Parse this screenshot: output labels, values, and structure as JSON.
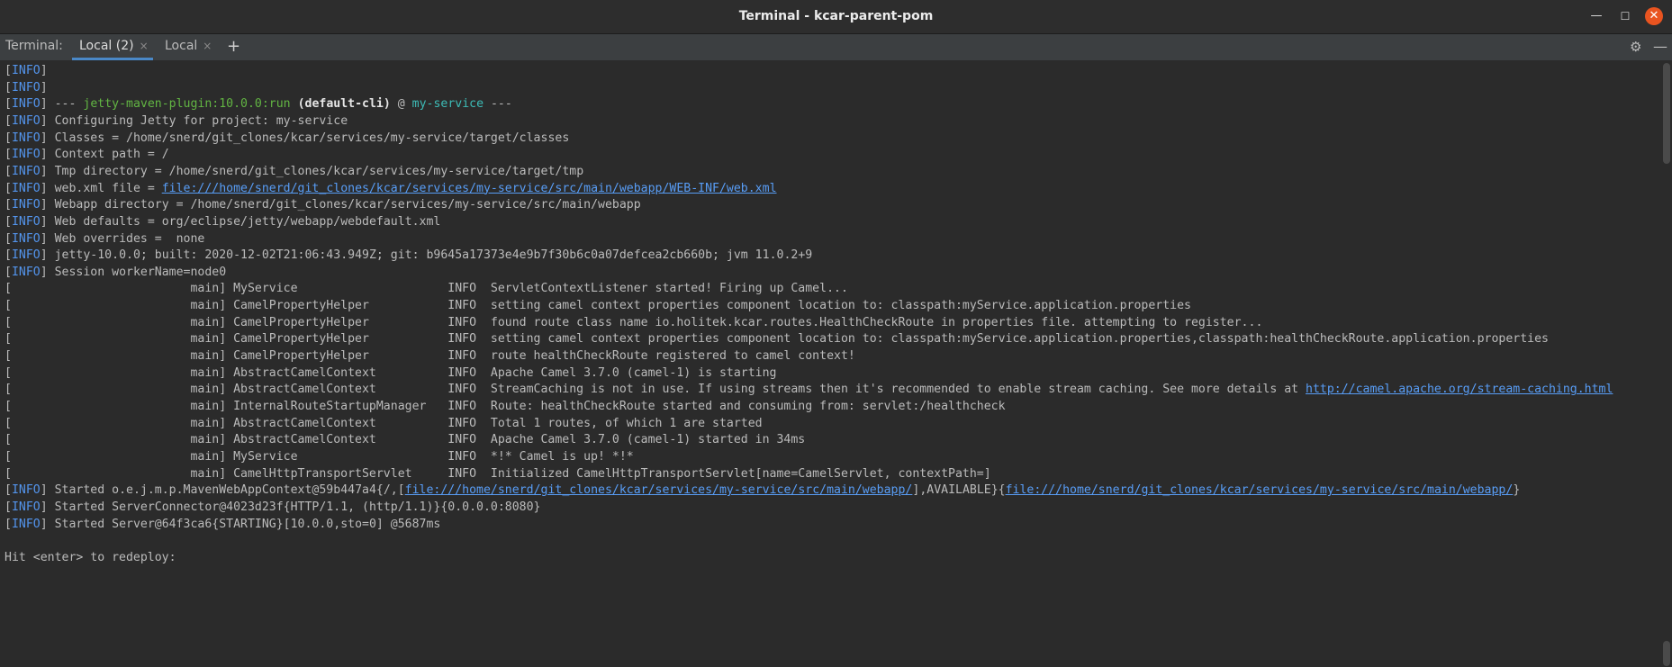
{
  "window": {
    "title": "Terminal - kcar-parent-pom",
    "minimize": "—",
    "maximize": "☐",
    "close": "✕"
  },
  "toolbar": {
    "label": "Terminal:",
    "tabs": [
      {
        "label": "Local (2)",
        "close": "×"
      },
      {
        "label": "Local",
        "close": "×"
      }
    ],
    "add": "+",
    "settings_glyph": "⚙",
    "hide_glyph": "—"
  },
  "log": {
    "tag": "INFO",
    "lines": [
      {
        "type": "info",
        "text": ""
      },
      {
        "type": "info",
        "text": ""
      },
      {
        "type": "plugin",
        "dashes": "---",
        "plugin": "jetty-maven-plugin:10.0.0:run",
        "exec": "(default-cli)",
        "at": "@",
        "module": "my-service",
        "end": "---"
      },
      {
        "type": "info",
        "text": "Configuring Jetty for project: my-service"
      },
      {
        "type": "info",
        "text": "Classes = /home/snerd/git_clones/kcar/services/my-service/target/classes"
      },
      {
        "type": "info",
        "text": "Context path = /"
      },
      {
        "type": "info",
        "text": "Tmp directory = /home/snerd/git_clones/kcar/services/my-service/target/tmp"
      },
      {
        "type": "info",
        "text": "web.xml file = ",
        "link": "file:///home/snerd/git_clones/kcar/services/my-service/src/main/webapp/WEB-INF/web.xml"
      },
      {
        "type": "info",
        "text": "Webapp directory = /home/snerd/git_clones/kcar/services/my-service/src/main/webapp"
      },
      {
        "type": "info",
        "text": "Web defaults = org/eclipse/jetty/webapp/webdefault.xml"
      },
      {
        "type": "info",
        "text": "Web overrides =  none"
      },
      {
        "type": "info",
        "text": "jetty-10.0.0; built: 2020-12-02T21:06:43.949Z; git: b9645a17373e4e9b7f30b6c0a07defcea2cb660b; jvm 11.0.2+9"
      },
      {
        "type": "info",
        "text": "Session workerName=node0"
      },
      {
        "type": "log",
        "thread": "main]",
        "logger": "MyService",
        "level": "INFO",
        "msg": "ServletContextListener started! Firing up Camel..."
      },
      {
        "type": "log",
        "thread": "main]",
        "logger": "CamelPropertyHelper",
        "level": "INFO",
        "msg": "setting camel context properties component location to: classpath:myService.application.properties"
      },
      {
        "type": "log",
        "thread": "main]",
        "logger": "CamelPropertyHelper",
        "level": "INFO",
        "msg": "found route class name io.holitek.kcar.routes.HealthCheckRoute in properties file. attempting to register..."
      },
      {
        "type": "log",
        "thread": "main]",
        "logger": "CamelPropertyHelper",
        "level": "INFO",
        "msg": "setting camel context properties component location to: classpath:myService.application.properties,classpath:healthCheckRoute.application.properties"
      },
      {
        "type": "log",
        "thread": "main]",
        "logger": "CamelPropertyHelper",
        "level": "INFO",
        "msg": "route healthCheckRoute registered to camel context!"
      },
      {
        "type": "log",
        "thread": "main]",
        "logger": "AbstractCamelContext",
        "level": "INFO",
        "msg": "Apache Camel 3.7.0 (camel-1) is starting"
      },
      {
        "type": "log",
        "thread": "main]",
        "logger": "AbstractCamelContext",
        "level": "INFO",
        "msg": "StreamCaching is not in use. If using streams then it's recommended to enable stream caching. See more details at ",
        "link": "http://camel.apache.org/stream-caching.html"
      },
      {
        "type": "log",
        "thread": "main]",
        "logger": "InternalRouteStartupManager",
        "level": "INFO",
        "msg": "Route: healthCheckRoute started and consuming from: servlet:/healthcheck"
      },
      {
        "type": "log",
        "thread": "main]",
        "logger": "AbstractCamelContext",
        "level": "INFO",
        "msg": "Total 1 routes, of which 1 are started"
      },
      {
        "type": "log",
        "thread": "main]",
        "logger": "AbstractCamelContext",
        "level": "INFO",
        "msg": "Apache Camel 3.7.0 (camel-1) started in 34ms"
      },
      {
        "type": "log",
        "thread": "main]",
        "logger": "MyService",
        "level": "INFO",
        "msg": "*!* Camel is up! *!*"
      },
      {
        "type": "log",
        "thread": "main]",
        "logger": "CamelHttpTransportServlet",
        "level": "INFO",
        "msg": "Initialized CamelHttpTransportServlet[name=CamelServlet, contextPath=]"
      },
      {
        "type": "info",
        "text": "Started o.e.j.m.p.MavenWebAppContext@59b447a4{/,[",
        "link": "file:///home/snerd/git_clones/kcar/services/my-service/src/main/webapp/",
        "text2": "],AVAILABLE}{",
        "link2": "file:///home/snerd/git_clones/kcar/services/my-service/src/main/webapp/",
        "text3": "}"
      },
      {
        "type": "info",
        "text": "Started ServerConnector@4023d23f{HTTP/1.1, (http/1.1)}{0.0.0.0:8080}"
      },
      {
        "type": "info",
        "text": "Started Server@64f3ca6{STARTING}[10.0.0,sto=0] @5687ms"
      },
      {
        "type": "blank"
      },
      {
        "type": "plain",
        "text": "Hit <enter> to redeploy:"
      }
    ]
  }
}
